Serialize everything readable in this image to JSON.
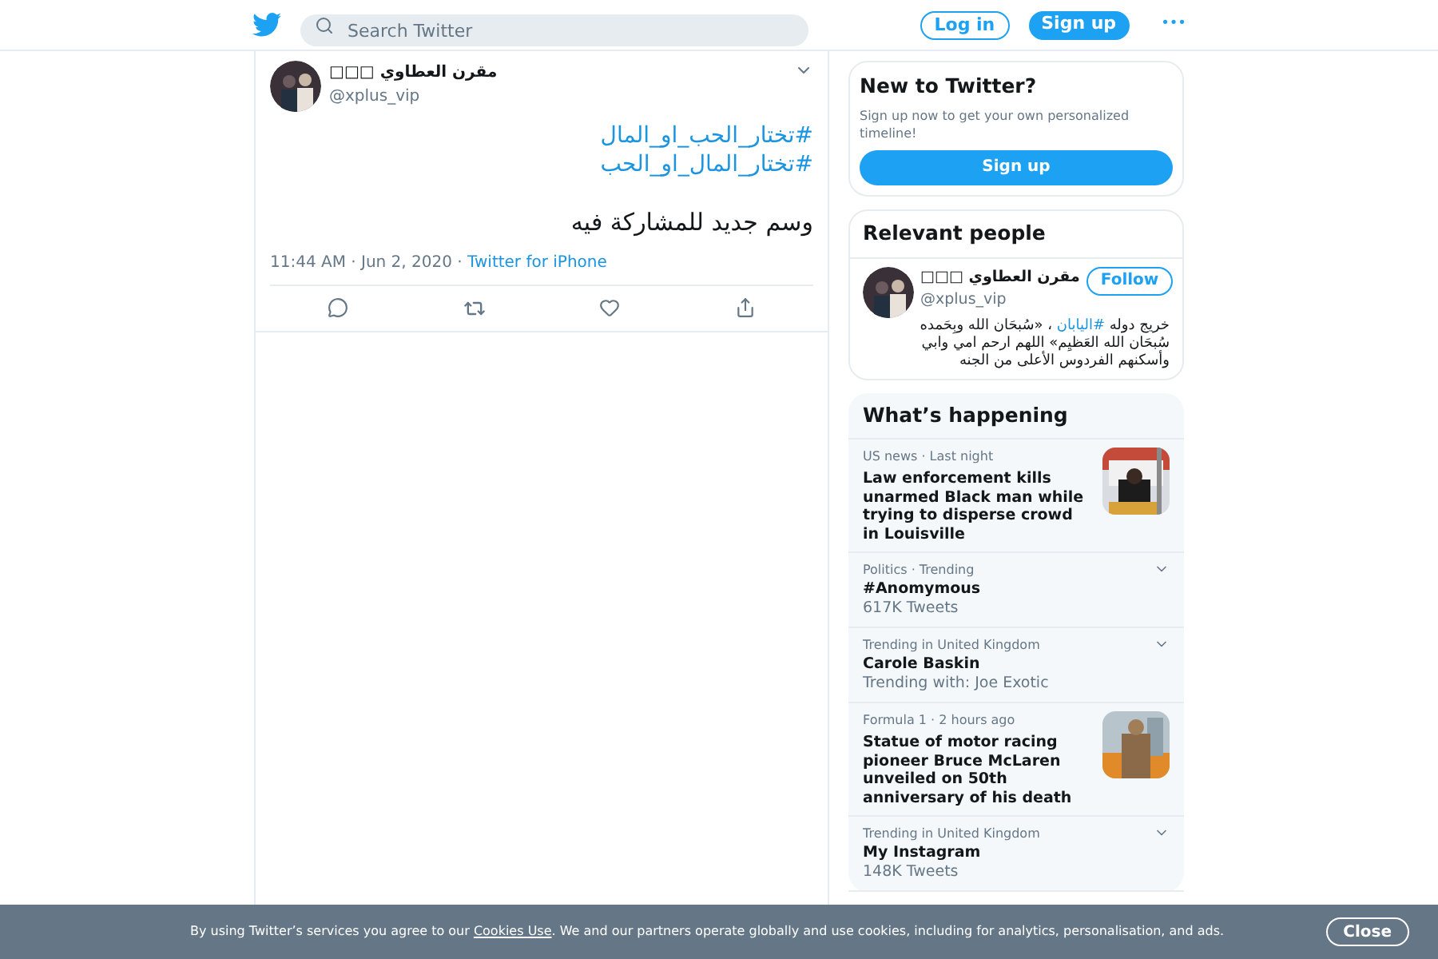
{
  "header": {
    "search": {
      "placeholder": "Search Twitter"
    },
    "login": "Log in",
    "signup": "Sign up",
    "more": "•••"
  },
  "tweet": {
    "name": "مقرن العطاوي □□□",
    "handle": "@xplus_vip",
    "hashtags": [
      "#تختار_الحب_او_المال",
      "#تختار_المال_او_الحب"
    ],
    "text": "وسم جديد للمشاركة فيه",
    "time": "11:44 AM · Jun 2, 2020",
    "source_sep": " · ",
    "source": "Twitter for iPhone"
  },
  "new_to_twitter": {
    "title": "New to Twitter?",
    "text": "Sign up now to get your own personalized timeline!",
    "button": "Sign up"
  },
  "relevant_people": {
    "title": "Relevant people",
    "person": {
      "name": "مقرن العطاوي □□□",
      "handle": "@xplus_vip",
      "follow": "Follow",
      "bio": "خريج دوله **#اليابان** ، «سُبحَان الله وبِحَمده سُبحَان الله العَظيِم» اللهم ارحم امي وابي وأسكنهم الفردوس الأعلى من الجنه"
    }
  },
  "whats_happening": {
    "title": "What’s happening",
    "items": [
      {
        "kind": "news",
        "meta": "US news · Last night",
        "title": "Law enforcement kills unarmed Black man while trying to disperse crowd in Louisville"
      },
      {
        "kind": "trend",
        "meta": "Politics · Trending",
        "title": "#Anomymous",
        "sub": "617K Tweets"
      },
      {
        "kind": "trend",
        "meta": "Trending in United Kingdom",
        "title": "Carole Baskin",
        "sub": "Trending with: Joe Exotic"
      },
      {
        "kind": "news",
        "meta": "Formula 1 · 2 hours ago",
        "title": "Statue of motor racing pioneer Bruce McLaren unveiled on 50th anniversary of his death"
      },
      {
        "kind": "trend",
        "meta": "Trending in United Kingdom",
        "title": "My Instagram",
        "sub": "148K Tweets"
      }
    ]
  },
  "cookie_banner": {
    "before": "By using Twitter’s services you agree to our ",
    "link": "Cookies Use",
    "after": ". We and our partners operate globally and use cookies, including for analytics, personalisation, and ads.",
    "close": "Close"
  }
}
